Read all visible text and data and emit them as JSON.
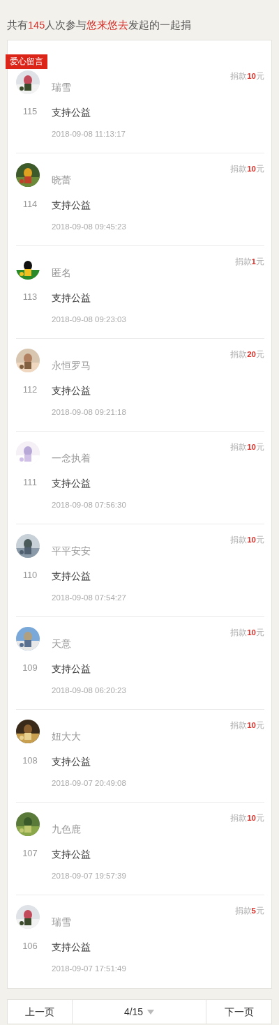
{
  "summary": [
    {
      "text": "共有",
      "highlight": false
    },
    {
      "text": "145",
      "highlight": true
    },
    {
      "text": "人次参与",
      "highlight": false
    },
    {
      "text": "悠来悠去",
      "highlight": true
    },
    {
      "text": "发起的一起捐",
      "highlight": false
    }
  ],
  "badge": "爱心留言",
  "donations": [
    {
      "name": "瑞雪",
      "number": "115",
      "message": "支持公益",
      "time": "2018-09-08 11:13:17",
      "amount_label": "捐款",
      "amount": "10",
      "unit": "元"
    },
    {
      "name": "晓蕾",
      "number": "114",
      "message": "支持公益",
      "time": "2018-09-08 09:45:23",
      "amount_label": "捐款",
      "amount": "10",
      "unit": "元"
    },
    {
      "name": "匿名",
      "number": "113",
      "message": "支持公益",
      "time": "2018-09-08 09:23:03",
      "amount_label": "捐款",
      "amount": "1",
      "unit": "元"
    },
    {
      "name": "永恒罗马",
      "number": "112",
      "message": "支持公益",
      "time": "2018-09-08 09:21:18",
      "amount_label": "捐款",
      "amount": "20",
      "unit": "元"
    },
    {
      "name": "一念执着",
      "number": "111",
      "message": "支持公益",
      "time": "2018-09-08 07:56:30",
      "amount_label": "捐款",
      "amount": "10",
      "unit": "元"
    },
    {
      "name": "平平安安",
      "number": "110",
      "message": "支持公益",
      "time": "2018-09-08 07:54:27",
      "amount_label": "捐款",
      "amount": "10",
      "unit": "元"
    },
    {
      "name": "天意",
      "number": "109",
      "message": "支持公益",
      "time": "2018-09-08 06:20:23",
      "amount_label": "捐款",
      "amount": "10",
      "unit": "元"
    },
    {
      "name": "妞大大",
      "number": "108",
      "message": "支持公益",
      "time": "2018-09-07 20:49:08",
      "amount_label": "捐款",
      "amount": "10",
      "unit": "元"
    },
    {
      "name": "九色鹿",
      "number": "107",
      "message": "支持公益",
      "time": "2018-09-07 19:57:39",
      "amount_label": "捐款",
      "amount": "10",
      "unit": "元"
    },
    {
      "name": "瑞雪",
      "number": "106",
      "message": "支持公益",
      "time": "2018-09-07 17:51:49",
      "amount_label": "捐款",
      "amount": "5",
      "unit": "元"
    }
  ],
  "pager": {
    "prev": "上一页",
    "page": "4/15",
    "next": "下一页"
  }
}
